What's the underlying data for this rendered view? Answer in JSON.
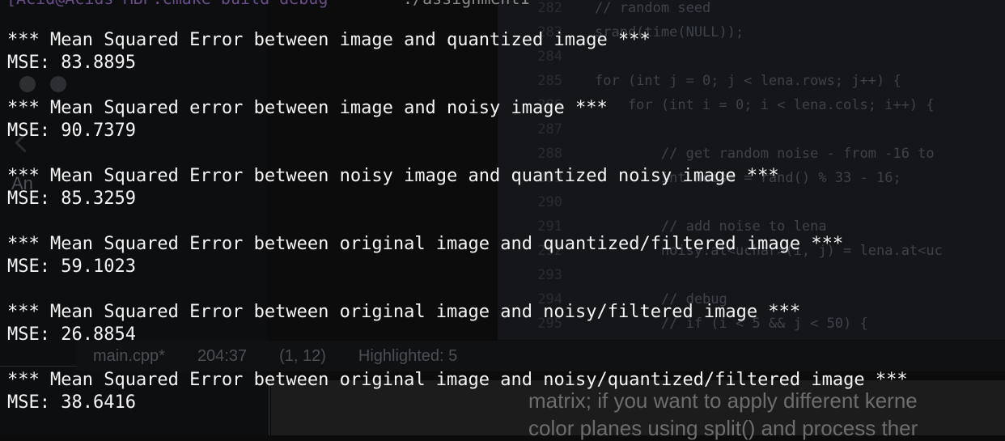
{
  "terminal": {
    "prompt_fragment": "[Acid@Acids-MBP:cmake-build-debug",
    "command_fragment": "./assignment1",
    "results": [
      {
        "header": "*** Mean Squared Error between image and quantized image ***",
        "mse": "MSE: 83.8895"
      },
      {
        "header": "*** Mean Squared error between image and noisy image ***",
        "mse": "MSE: 90.7379"
      },
      {
        "header": "*** Mean Squared Error between noisy image and quantized noisy image ***",
        "mse": "MSE: 85.3259"
      },
      {
        "header": "*** Mean Squared Error between original image and quantized/filtered image ***",
        "mse": "MSE: 59.1023"
      },
      {
        "header": "*** Mean Squared Error between original image and noisy/filtered image ***",
        "mse": "MSE: 26.8854"
      },
      {
        "header": "*** Mean Squared Error between original image and noisy/quantized/filtered image ***",
        "mse": "MSE: 38.6416"
      }
    ]
  },
  "editor_background": {
    "lines": [
      {
        "num": "282",
        "code": "// random seed"
      },
      {
        "num": "283",
        "code": "srand(time(NULL));"
      },
      {
        "num": "284",
        "code": ""
      },
      {
        "num": "285",
        "code": "for (int j = 0; j < lena.rows; j++) {"
      },
      {
        "num": "286",
        "code": "    for (int i = 0; i < lena.cols; i++) {"
      },
      {
        "num": "287",
        "code": ""
      },
      {
        "num": "288",
        "code": "        // get random noise - from -16 to"
      },
      {
        "num": "289",
        "code": "        int noise = rand() % 33 - 16;"
      },
      {
        "num": "290",
        "code": ""
      },
      {
        "num": "291",
        "code": "        // add noise to lena"
      },
      {
        "num": "292",
        "code": "        noisy.at<uchar>(i, j) = lena.at<uc"
      },
      {
        "num": "293",
        "code": ""
      },
      {
        "num": "294",
        "code": "        // debug"
      },
      {
        "num": "295",
        "code": "        // if (i < 5 && j < 50) {"
      }
    ],
    "status": {
      "file": "main.cpp*",
      "position": "204:37",
      "selection": "(1, 12)",
      "highlighted": "Highlighted: 5"
    },
    "left_label": "An"
  },
  "doc_background": {
    "line1": "matrix; if you want to apply different kerne",
    "line2": "color planes using split() and process ther"
  }
}
